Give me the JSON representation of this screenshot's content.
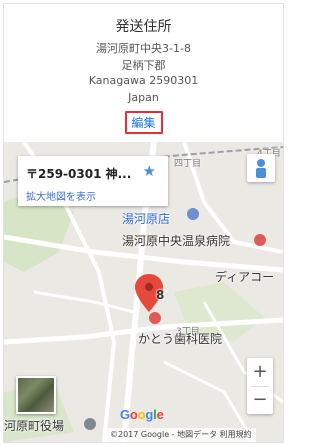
{
  "address": {
    "title": "発送住所",
    "lines": [
      "湯河原町中央3-1-8",
      "足柄下郡",
      "Kanagawa 2590301",
      "Japan"
    ],
    "edit_label": "編集"
  },
  "map": {
    "info": {
      "title": "〒259-0301 神...",
      "star_icon": "star-icon",
      "link": "拡大地図を表示"
    },
    "labels": {
      "shop": "湯河原店",
      "hospital": "湯河原中央温泉病院",
      "store": "ディアコー",
      "dental": "かとう歯科医院",
      "chome4": "4丁目",
      "chome3": "3丁目",
      "chome4b": "四丁目",
      "pin_number": "8",
      "townhall": "河原町役場"
    },
    "zoom_in": "+",
    "zoom_out": "−",
    "logo": "Google",
    "logo_colors": [
      "#4285f4",
      "#ea4335",
      "#fbbc05",
      "#4285f4",
      "#34a853",
      "#ea4335"
    ],
    "footer": "©2017 Google - 地図データ   利用規約"
  },
  "colors": {
    "edit_border": "#e0303a",
    "link_blue": "#1a73e8",
    "pin_red": "#e5493b"
  }
}
